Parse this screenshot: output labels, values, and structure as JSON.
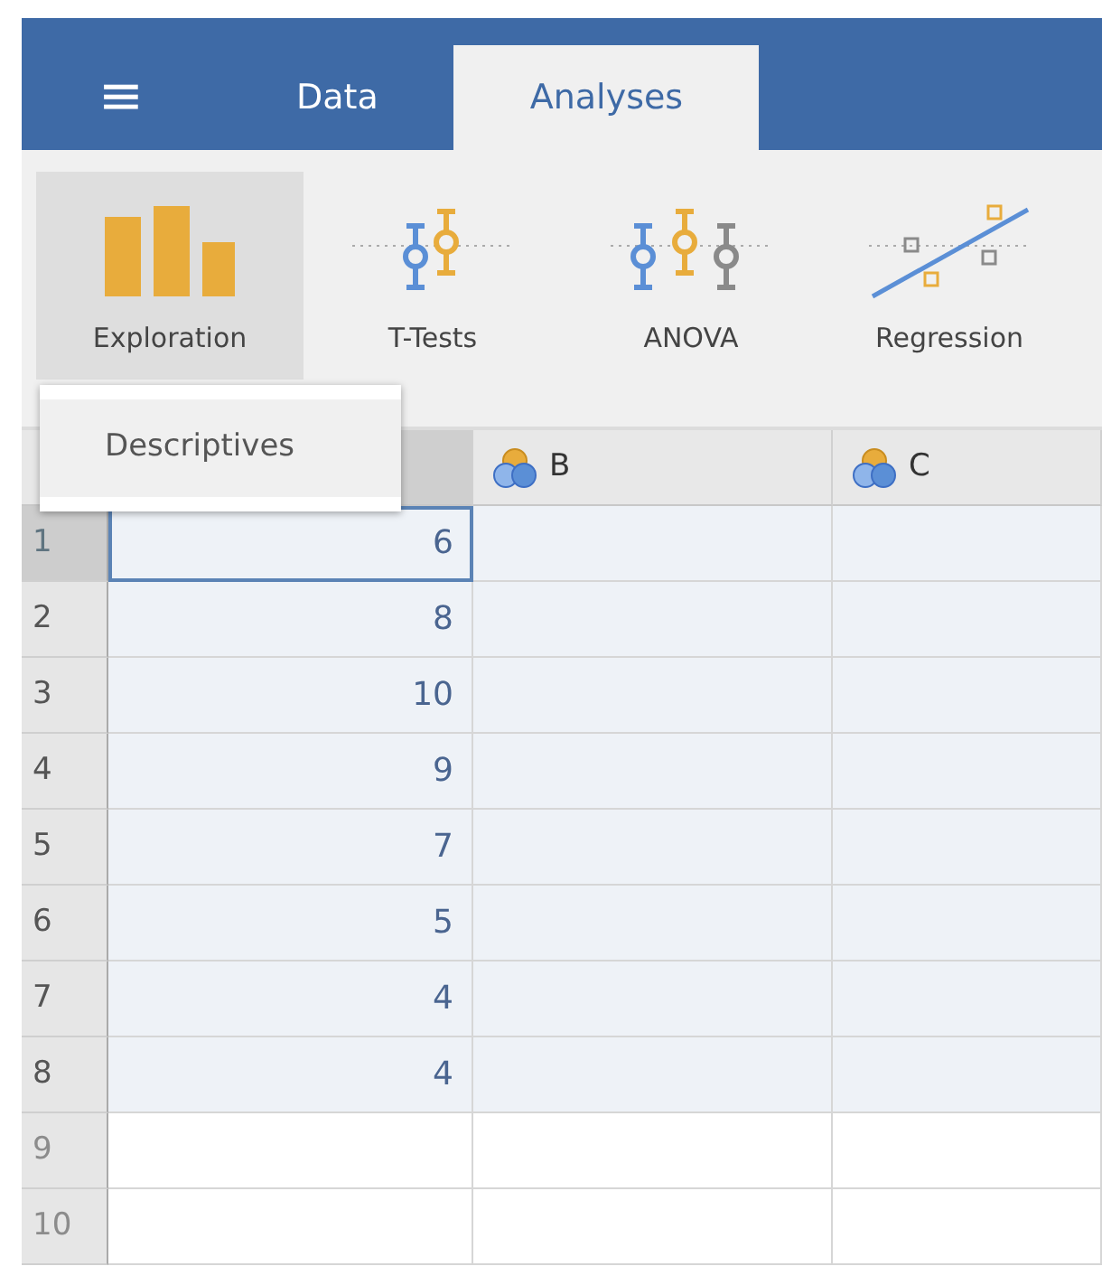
{
  "menu_icon": "≡",
  "tabs": [
    {
      "label": "Data",
      "selected": false
    },
    {
      "label": "Analyses",
      "selected": true
    }
  ],
  "toolbar": [
    {
      "label": "Exploration",
      "kind": "bars",
      "selected": true
    },
    {
      "label": "T-Tests",
      "kind": "ttest",
      "selected": false
    },
    {
      "label": "ANOVA",
      "kind": "anova",
      "selected": false
    },
    {
      "label": "Regression",
      "kind": "regression",
      "selected": false
    }
  ],
  "dropdown": {
    "items": [
      {
        "label": "Descriptives"
      }
    ]
  },
  "columns": [
    {
      "label": "B"
    },
    {
      "label": "C"
    }
  ],
  "rows": [
    {
      "number": "1",
      "value": "6",
      "filled": true,
      "selected": true
    },
    {
      "number": "2",
      "value": "8",
      "filled": true,
      "selected": false
    },
    {
      "number": "3",
      "value": "10",
      "filled": true,
      "selected": false
    },
    {
      "number": "4",
      "value": "9",
      "filled": true,
      "selected": false
    },
    {
      "number": "5",
      "value": "7",
      "filled": true,
      "selected": false
    },
    {
      "number": "6",
      "value": "5",
      "filled": true,
      "selected": false
    },
    {
      "number": "7",
      "value": "4",
      "filled": true,
      "selected": false
    },
    {
      "number": "8",
      "value": "4",
      "filled": true,
      "selected": false
    },
    {
      "number": "9",
      "filled": false,
      "selected": false
    },
    {
      "number": "10",
      "filled": false,
      "selected": false
    }
  ]
}
